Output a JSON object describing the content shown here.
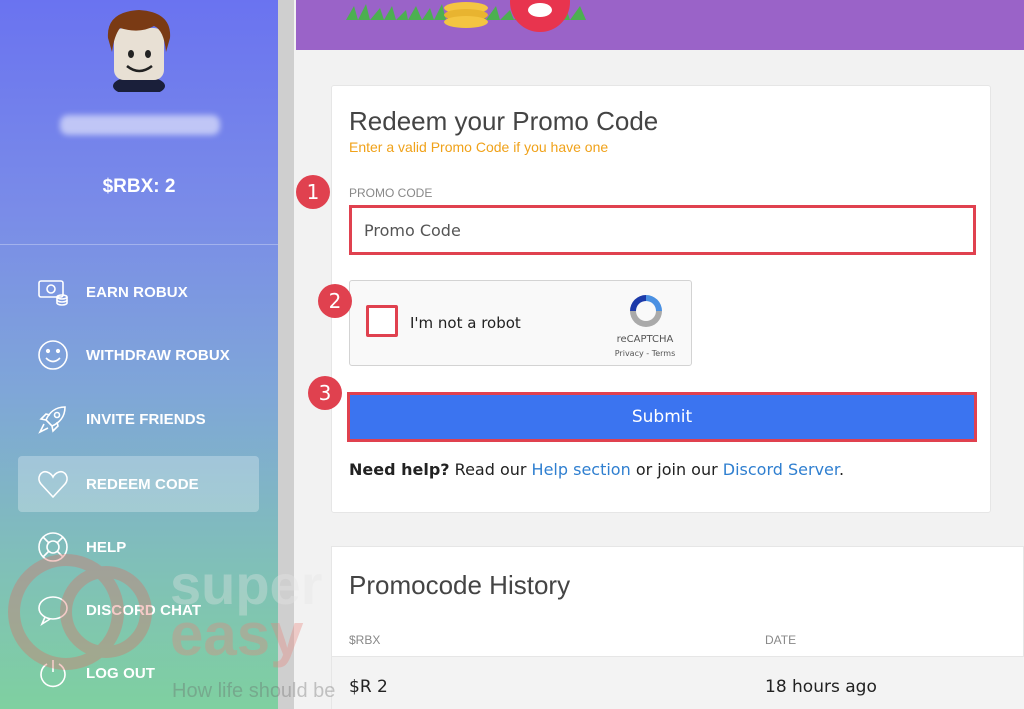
{
  "sidebar": {
    "balance": "$RBX: 2",
    "items": [
      {
        "label": "EARN ROBUX",
        "icon": "money-icon"
      },
      {
        "label": "WITHDRAW ROBUX",
        "icon": "smiley-icon"
      },
      {
        "label": "INVITE FRIENDS",
        "icon": "rocket-icon"
      },
      {
        "label": "REDEEM CODE",
        "icon": "heart-icon"
      },
      {
        "label": "HELP",
        "icon": "lifebuoy-icon"
      },
      {
        "label": "DISCORD CHAT",
        "icon": "chat-icon"
      },
      {
        "label": "LOG OUT",
        "icon": "power-icon"
      }
    ]
  },
  "redeem": {
    "title": "Redeem your Promo Code",
    "subtitle": "Enter a valid Promo Code if you have one",
    "field_label": "PROMO CODE",
    "placeholder": "Promo Code",
    "captcha": {
      "text": "I'm not a robot",
      "brand": "reCAPTCHA",
      "links": "Privacy - Terms"
    },
    "submit_label": "Submit",
    "help": {
      "prefix": "Need help?",
      "text1": " Read our ",
      "link1": "Help section",
      "text2": " or join our ",
      "link2": "Discord Server",
      "suffix": "."
    }
  },
  "badges": [
    "1",
    "2",
    "3"
  ],
  "history": {
    "title": "Promocode History",
    "columns": [
      "$RBX",
      "DATE"
    ],
    "rows": [
      {
        "rbx": "$R 2",
        "date": "18 hours ago"
      }
    ]
  },
  "watermark": {
    "line1": "super",
    "line2": "easy",
    "line3": "How life should be"
  },
  "colors": {
    "accent": "#3b74f0",
    "highlight": "#e0414f",
    "subtitle": "#f0a21a",
    "banner": "#9a63c8"
  }
}
